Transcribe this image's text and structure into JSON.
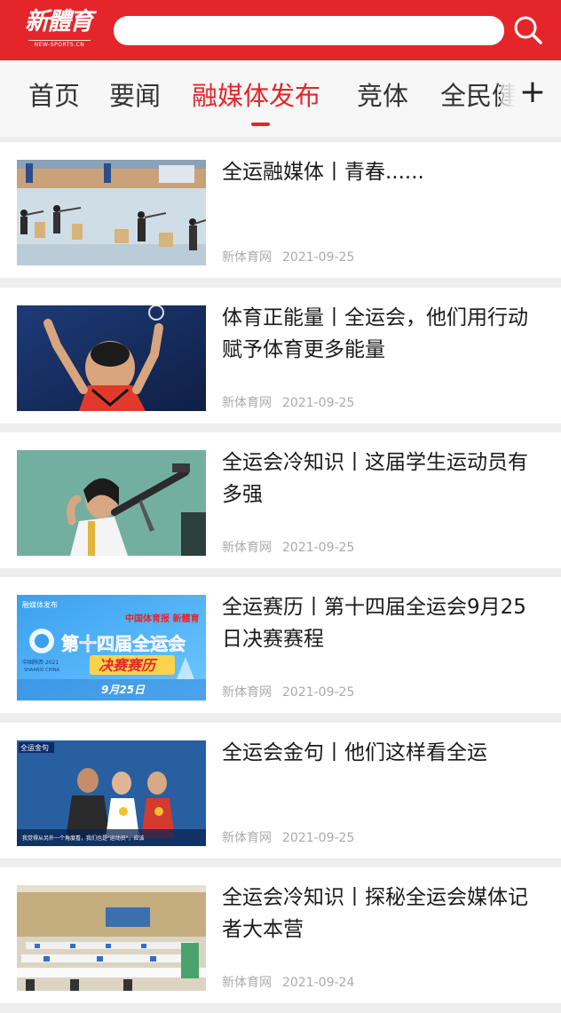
{
  "header": {
    "logo_text": "新體育",
    "logo_subtext": "NEW-SPORTS.CN",
    "search_placeholder": "",
    "search_icon": "search-icon"
  },
  "tabs": [
    {
      "label": "首页",
      "active": false
    },
    {
      "label": "要闻",
      "active": false
    },
    {
      "label": "融媒体发布",
      "active": true
    },
    {
      "label": "竞体",
      "active": false
    },
    {
      "label": "全民健",
      "active": false
    }
  ],
  "add_tab_label": "+",
  "articles": [
    {
      "title": "全运融媒体丨青春......",
      "source": "新体育网",
      "date": "2021-09-25",
      "image": "shooting-range-photo"
    },
    {
      "title": "体育正能量丨全运会，他们用行动赋予体育更多能量",
      "source": "新体育网",
      "date": "2021-09-25",
      "image": "badminton-player-photo"
    },
    {
      "title": "全运会冷知识丨这届学生运动员有多强",
      "source": "新体育网",
      "date": "2021-09-25",
      "image": "rifle-shooter-photo"
    },
    {
      "title": "全运赛历丨第十四届全运会9月25日决赛赛程",
      "source": "新体育网",
      "date": "2021-09-25",
      "image": "schedule-poster",
      "poster": {
        "tag": "融媒体发布",
        "brand": "中国体育报 新體育",
        "headline": "第十四届全运会",
        "sub": "决赛赛历",
        "date": "9月25日",
        "region": "中国陕西 2021",
        "region_en": "SHAANXI CHINA"
      }
    },
    {
      "title": "全运会金句丨他们这样看全运",
      "source": "新体育网",
      "date": "2021-09-25",
      "image": "athletes-medals-photo",
      "overlay": {
        "tag": "全运金句",
        "caption": "我觉得从另外一个角度看，我们也是\"运动员\"，应该"
      }
    },
    {
      "title": "全运会冷知识丨探秘全运会媒体记者大本营",
      "source": "新体育网",
      "date": "2021-09-24",
      "image": "press-center-photo"
    }
  ],
  "colors": {
    "brand_red": "#e4262b",
    "tab_bg": "#f7f7f7",
    "meta_gray": "#aaaaaa"
  }
}
